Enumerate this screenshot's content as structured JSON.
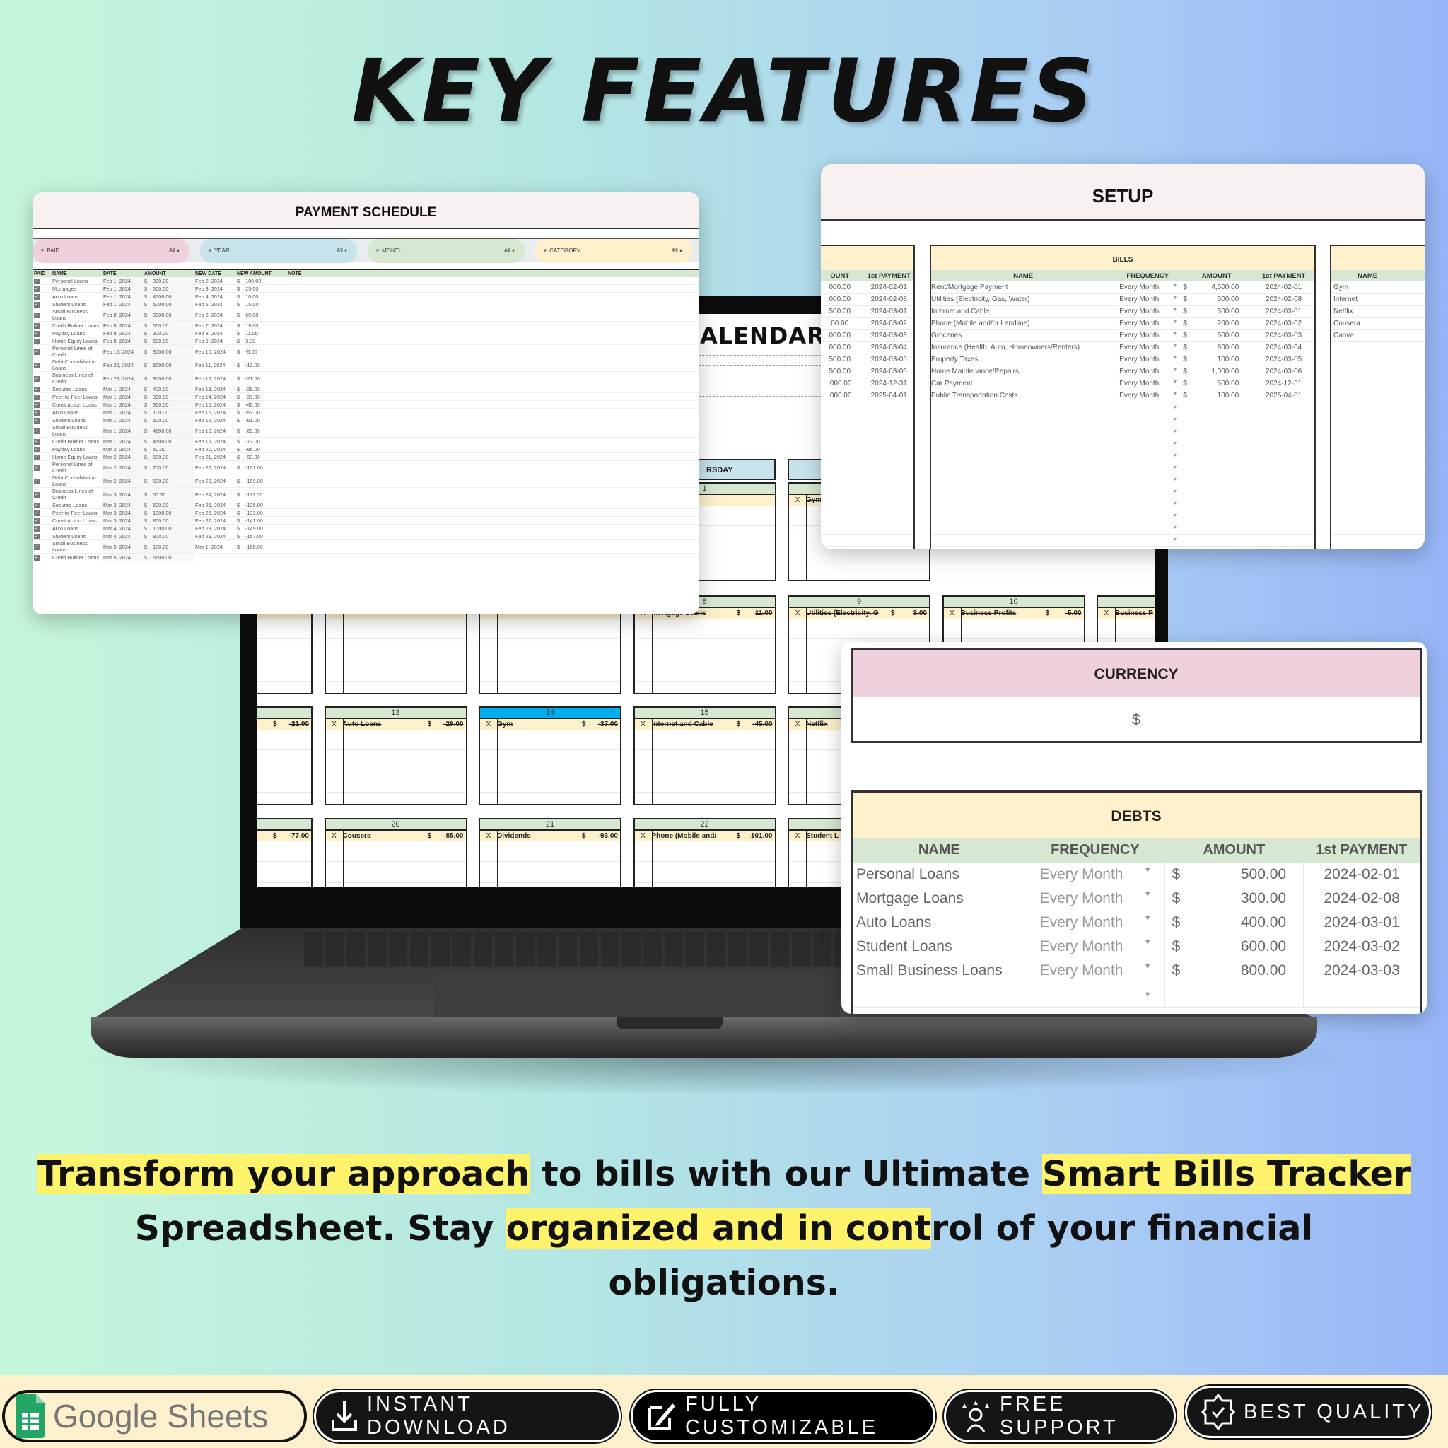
{
  "headline": "KEY FEATURES",
  "calendar": {
    "title": "ALENDAR",
    "weekday_label": "RSDAY",
    "weeks": [
      [
        null,
        null,
        null,
        {
          "day": "1"
        },
        {
          "day": "",
          "mark": "X",
          "name": "Gym"
        },
        null,
        null
      ],
      [
        {
          "day": ""
        },
        {
          "day": ""
        },
        {
          "day": ""
        },
        {
          "day": "8",
          "mark": "X",
          "name": "Mortgage Loans",
          "currency": "$",
          "amount": "11.00"
        },
        {
          "day": "9",
          "mark": "X",
          "name": "Utilities (Electricity, G",
          "currency": "$",
          "amount": "3.00"
        },
        {
          "day": "10",
          "mark": "X",
          "name": "Business Profits",
          "currency": "$",
          "amount": "-5.00"
        },
        {
          "day": "",
          "mark": "X",
          "name": "Business P"
        }
      ],
      [
        {
          "day": "",
          "currency": "$",
          "amount": "-21.00"
        },
        {
          "day": "13",
          "mark": "X",
          "name": "Auto Loans",
          "currency": "$",
          "amount": "-29.00"
        },
        {
          "day": "14",
          "today": true,
          "mark": "X",
          "name": "Gym",
          "currency": "$",
          "amount": "-37.00"
        },
        {
          "day": "15",
          "mark": "X",
          "name": "Internet and Cable",
          "currency": "$",
          "amount": "-45.00"
        },
        {
          "day": "",
          "mark": "X",
          "name": "Netflix"
        },
        null,
        null
      ],
      [
        {
          "day": "",
          "currency": "$",
          "amount": "-77.00"
        },
        {
          "day": "20",
          "mark": "X",
          "name": "Cousera",
          "currency": "$",
          "amount": "-85.00"
        },
        {
          "day": "21",
          "mark": "X",
          "name": "Dividends",
          "currency": "$",
          "amount": "-93.00"
        },
        {
          "day": "22",
          "mark": "X",
          "name": "Phone (Mobile and/",
          "currency": "$",
          "amount": "-101.00"
        },
        {
          "day": "",
          "mark": "X",
          "name": "Student L"
        },
        null,
        null
      ]
    ]
  },
  "payment_schedule": {
    "title": "PAYMENT SCHEDULE",
    "filters": [
      {
        "label": "PAID",
        "value": "All",
        "color": "#efd0de"
      },
      {
        "label": "YEAR",
        "value": "All",
        "color": "#c7e3eb"
      },
      {
        "label": "MONTH",
        "value": "All",
        "color": "#d6e8d1"
      },
      {
        "label": "CATEGORY",
        "value": "All",
        "color": "#fef1cc"
      }
    ],
    "columns": [
      "PAID",
      "NAME",
      "DATE",
      "AMOUNT",
      "NEW DATE",
      "NEW AMOUNT",
      "NOTE"
    ],
    "currency": "$",
    "rows": [
      {
        "name": "Personal Loans",
        "date": "Feb 1, 2024",
        "amount": "300.00",
        "new_date": "Feb 2, 2024",
        "new_amount": "100.00"
      },
      {
        "name": "Mortgages",
        "date": "Feb 1, 2024",
        "amount": "500.00",
        "new_date": "Feb 3, 2024",
        "new_amount": "25.00"
      },
      {
        "name": "Auto Loans",
        "date": "Feb 1, 2024",
        "amount": "4500.00",
        "new_date": "Feb 4, 2024",
        "new_amount": "10.00"
      },
      {
        "name": "Student Loans",
        "date": "Feb 1, 2024",
        "amount": "5000.00",
        "new_date": "Feb 5, 2024",
        "new_amount": "15.00"
      },
      {
        "name": "Small Business Loans",
        "date": "Feb 8, 2024",
        "amount": "8000.00",
        "new_date": "Feb 6, 2024",
        "new_amount": "65.00"
      },
      {
        "name": "Credit Builder Loans",
        "date": "Feb 8, 2024",
        "amount": "500.00",
        "new_date": "Feb 7, 2024",
        "new_amount": "19.00"
      },
      {
        "name": "Payday Loans",
        "date": "Feb 8, 2024",
        "amount": "300.00",
        "new_date": "Feb 8, 2024",
        "new_amount": "11.00"
      },
      {
        "name": "Home Equity Loans",
        "date": "Feb 8, 2024",
        "amount": "500.00",
        "new_date": "Feb 9, 2024",
        "new_amount": "3.00"
      },
      {
        "name": "Personal Lines of Credit",
        "date": "Feb 15, 2024",
        "amount": "8000.00",
        "new_date": "Feb 10, 2024",
        "new_amount": "-5.00"
      },
      {
        "name": "Debt Consolidation Loans",
        "date": "Feb 22, 2024",
        "amount": "8000.00",
        "new_date": "Feb 11, 2024",
        "new_amount": "-13.00"
      },
      {
        "name": "Business Lines of Credit",
        "date": "Feb 29, 2024",
        "amount": "8000.00",
        "new_date": "Feb 12, 2024",
        "new_amount": "-21.00"
      },
      {
        "name": "Secured Loans",
        "date": "Mar 1, 2024",
        "amount": "400.00",
        "new_date": "Feb 13, 2024",
        "new_amount": "-29.00"
      },
      {
        "name": "Peer-to-Peer Loans",
        "date": "Mar 1, 2024",
        "amount": "300.00",
        "new_date": "Feb 14, 2024",
        "new_amount": "-37.00"
      },
      {
        "name": "Construction Loans",
        "date": "Mar 1, 2024",
        "amount": "300.00",
        "new_date": "Feb 15, 2024",
        "new_amount": "-45.00"
      },
      {
        "name": "Auto Loans",
        "date": "Mar 1, 2024",
        "amount": "100.00",
        "new_date": "Feb 16, 2024",
        "new_amount": "-53.00"
      },
      {
        "name": "Student Loans",
        "date": "Mar 1, 2024",
        "amount": "500.00",
        "new_date": "Feb 17, 2024",
        "new_amount": "-61.00"
      },
      {
        "name": "Small Business Loans",
        "date": "Mar 1, 2024",
        "amount": "4500.00",
        "new_date": "Feb 18, 2024",
        "new_amount": "-69.00"
      },
      {
        "name": "Credit Builder Loans",
        "date": "Mar 1, 2024",
        "amount": "4500.00",
        "new_date": "Feb 19, 2024",
        "new_amount": "-77.00"
      },
      {
        "name": "Payday Loans",
        "date": "Mar 2, 2024",
        "amount": "50.00",
        "new_date": "Feb 20, 2024",
        "new_amount": "-85.00"
      },
      {
        "name": "Home Equity Loans",
        "date": "Mar 2, 2024",
        "amount": "500.00",
        "new_date": "Feb 21, 2024",
        "new_amount": "-93.00"
      },
      {
        "name": "Personal Lines of Credit",
        "date": "Mar 2, 2024",
        "amount": "200.00",
        "new_date": "Feb 22, 2024",
        "new_amount": "-101.00"
      },
      {
        "name": "Debt Consolidation Loans",
        "date": "Mar 2, 2024",
        "amount": "600.00",
        "new_date": "Feb 23, 2024",
        "new_amount": "-109.00"
      },
      {
        "name": "Business Lines of Credit",
        "date": "Mar 3, 2024",
        "amount": "50.00",
        "new_date": "Feb 24, 2024",
        "new_amount": "-117.00"
      },
      {
        "name": "Secured Loans",
        "date": "Mar 3, 2024",
        "amount": "600.00",
        "new_date": "Feb 25, 2024",
        "new_amount": "-125.00"
      },
      {
        "name": "Peer-to-Peer Loans",
        "date": "Mar 3, 2024",
        "amount": "1000.00",
        "new_date": "Feb 26, 2024",
        "new_amount": "-133.00"
      },
      {
        "name": "Construction Loans",
        "date": "Mar 3, 2024",
        "amount": "800.00",
        "new_date": "Feb 27, 2024",
        "new_amount": "-141.00"
      },
      {
        "name": "Auto Loans",
        "date": "Mar 4, 2024",
        "amount": "1000.00",
        "new_date": "Feb 28, 2024",
        "new_amount": "-149.00"
      },
      {
        "name": "Student Loans",
        "date": "Mar 4, 2024",
        "amount": "800.00",
        "new_date": "Feb 29, 2024",
        "new_amount": "-157.00"
      },
      {
        "name": "Small Business Loans",
        "date": "Mar 5, 2024",
        "amount": "100.00",
        "new_date": "Mar 1, 2024",
        "new_amount": "-165.00"
      },
      {
        "name": "Credit Builder Loans",
        "date": "Mar 5, 2024",
        "amount": "5500.00",
        "new_date": "",
        "new_amount": ""
      }
    ]
  },
  "setup": {
    "title": "SETUP",
    "left_partial": {
      "columns": [
        "OUNT",
        "1st PAYMENT"
      ],
      "rows": [
        [
          "000.00",
          "2024-02-01"
        ],
        [
          "000.00",
          "2024-02-08"
        ],
        [
          "500.00",
          "2024-03-01"
        ],
        [
          "00.00",
          "2024-03-02"
        ],
        [
          "000.00",
          "2024-03-03"
        ],
        [
          "000.00",
          "2024-03-04"
        ],
        [
          "500.00",
          "2024-03-05"
        ],
        [
          "500.00",
          "2024-03-06"
        ],
        [
          ",000.00",
          "2024-12-31"
        ],
        [
          ",000.00",
          "2025-04-01"
        ]
      ]
    },
    "bills": {
      "title": "BILLS",
      "columns": [
        "NAME",
        "FREQUENCY",
        "AMOUNT",
        "1st PAYMENT"
      ],
      "currency": "$",
      "rows": [
        {
          "name": "Rent/Mortgage Payment",
          "frequency": "Every Month",
          "amount": "4,500.00",
          "first": "2024-02-01"
        },
        {
          "name": "Utilities (Electricity, Gas, Water)",
          "frequency": "Every Month",
          "amount": "500.00",
          "first": "2024-02-08"
        },
        {
          "name": "Internet and Cable",
          "frequency": "Every Month",
          "amount": "300.00",
          "first": "2024-03-01"
        },
        {
          "name": "Phone (Mobile and/or Landline)",
          "frequency": "Every Month",
          "amount": "200.00",
          "first": "2024-03-02"
        },
        {
          "name": "Groceries",
          "frequency": "Every Month",
          "amount": "600.00",
          "first": "2024-03-03"
        },
        {
          "name": "Insurance (Health, Auto, Homeowners/Renters)",
          "frequency": "Every Month",
          "amount": "800.00",
          "first": "2024-03-04"
        },
        {
          "name": "Property Taxes",
          "frequency": "Every Month",
          "amount": "100.00",
          "first": "2024-03-05"
        },
        {
          "name": "Home Maintenance/Repairs",
          "frequency": "Every Month",
          "amount": "1,000.00",
          "first": "2024-03-06"
        },
        {
          "name": "Car Payment",
          "frequency": "Every Month",
          "amount": "500.00",
          "first": "2024-12-31"
        },
        {
          "name": "Public Transportation Costs",
          "frequency": "Every Month",
          "amount": "100.00",
          "first": "2025-04-01"
        }
      ]
    },
    "subscriptions": {
      "columns": [
        "NAME"
      ],
      "rows": [
        "Gym",
        "Internet",
        "Netflix",
        "Cousera",
        "Canva"
      ]
    }
  },
  "currency_panel": {
    "title": "CURRENCY",
    "value": "$"
  },
  "debts": {
    "title": "DEBTS",
    "columns": [
      "NAME",
      "FREQUENCY",
      "AMOUNT",
      "1st PAYMENT"
    ],
    "currency": "$",
    "rows": [
      {
        "name": "Personal Loans",
        "frequency": "Every Month",
        "amount": "500.00",
        "first": "2024-02-01"
      },
      {
        "name": "Mortgage Loans",
        "frequency": "Every Month",
        "amount": "300.00",
        "first": "2024-02-08"
      },
      {
        "name": "Auto Loans",
        "frequency": "Every Month",
        "amount": "400.00",
        "first": "2024-03-01"
      },
      {
        "name": "Student Loans",
        "frequency": "Every Month",
        "amount": "600.00",
        "first": "2024-03-02"
      },
      {
        "name": "Small Business Loans",
        "frequency": "Every Month",
        "amount": "800.00",
        "first": "2024-03-03"
      }
    ]
  },
  "tagline": {
    "line1": [
      {
        "text": "Transform your approach",
        "hl": true
      },
      {
        "text": " to bills with our Ultimate ",
        "hl": false
      },
      {
        "text": "Smart Bills Tracker",
        "hl": true
      }
    ],
    "line2": [
      {
        "text": "Spreadsheet. Stay ",
        "hl": false
      },
      {
        "text": "organized and in cont",
        "hl": true
      },
      {
        "text": "rol of your financial",
        "hl": false
      }
    ],
    "line3": [
      {
        "text": "obligations.",
        "hl": false
      }
    ],
    "highlight_color": "#fff36b"
  },
  "badges": {
    "google_sheets": "Google Sheets",
    "instant_download": "INSTANT DOWNLOAD",
    "fully_customizable": "FULLY CUSTOMIZABLE",
    "free_support": "FREE SUPPORT",
    "best_quality": "BEST QUALITY"
  }
}
